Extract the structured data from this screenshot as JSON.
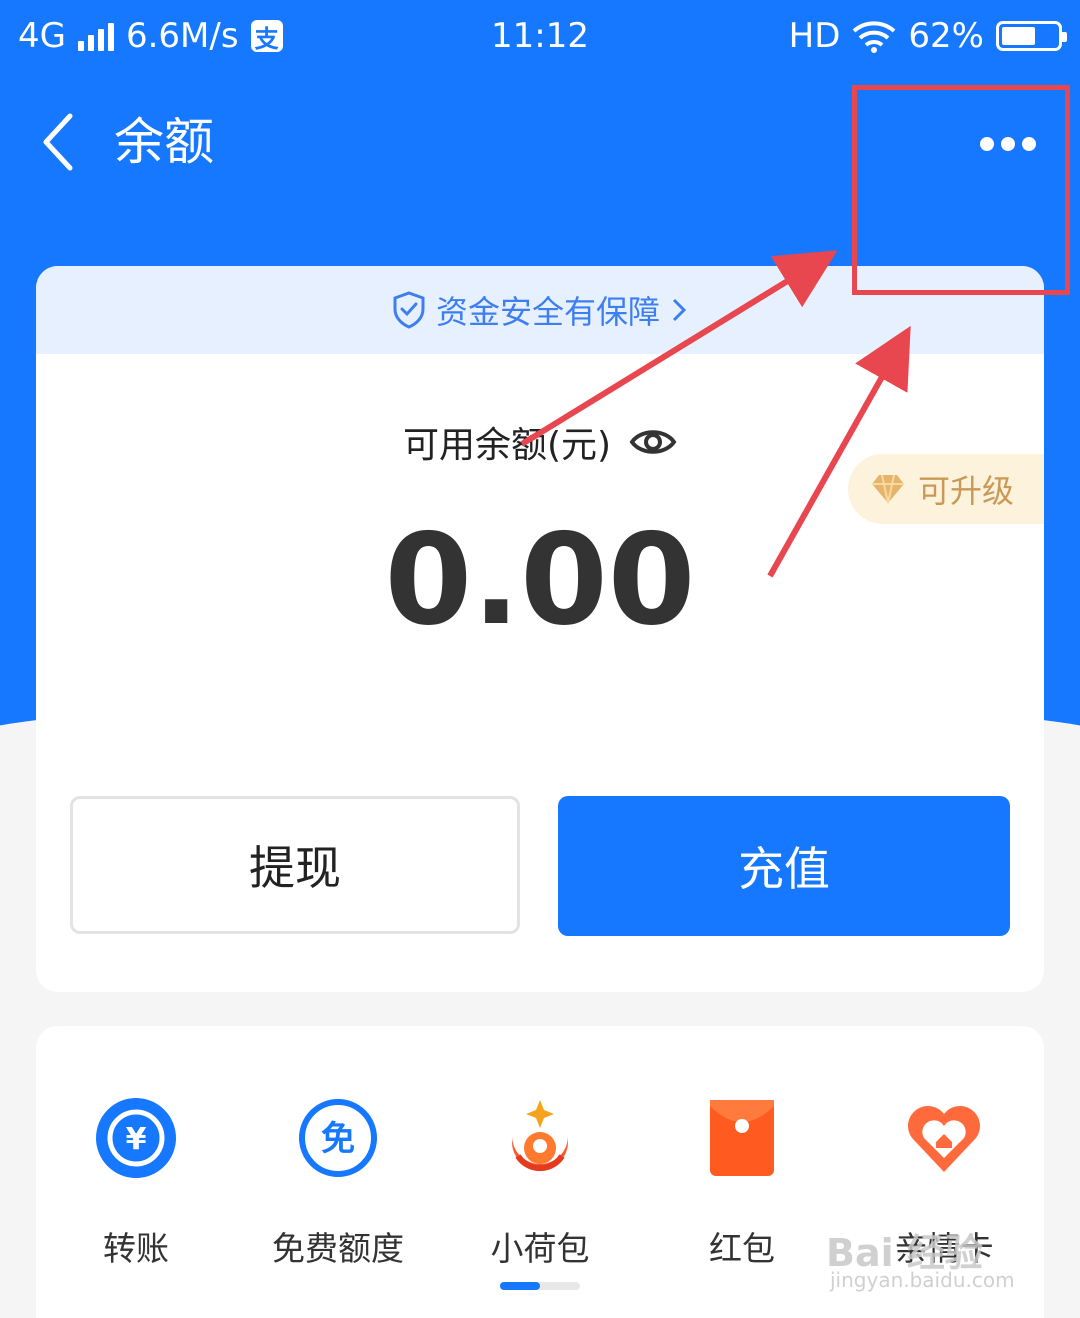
{
  "status_bar": {
    "network": "4G",
    "speed": "6.6M/s",
    "alipay_badge": "支",
    "time": "11:12",
    "hd": "HD",
    "battery_percent": "62%",
    "battery_level": 0.62
  },
  "nav": {
    "title": "余额"
  },
  "card": {
    "safety_text": "资金安全有保障",
    "balance_label": "可用余额(元)",
    "balance_amount": "0.00",
    "upgrade_label": "可升级",
    "withdraw_label": "提现",
    "recharge_label": "充值"
  },
  "services": {
    "items": [
      {
        "label": "转账",
        "icon": "transfer-icon",
        "glyph": "¥"
      },
      {
        "label": "免费额度",
        "icon": "free-quota-icon",
        "glyph": "免"
      },
      {
        "label": "小荷包",
        "icon": "small-pouch-icon"
      },
      {
        "label": "红包",
        "icon": "red-envelope-icon"
      },
      {
        "label": "亲情卡",
        "icon": "family-card-icon"
      }
    ],
    "scroll_position": 0.5
  },
  "watermark": {
    "text": "Bai 经验",
    "sub": "jingyan.baidu.com"
  },
  "colors": {
    "brand_blue": "#1677ff",
    "annotation_red": "#e8474f",
    "gold": "#c99a55"
  }
}
